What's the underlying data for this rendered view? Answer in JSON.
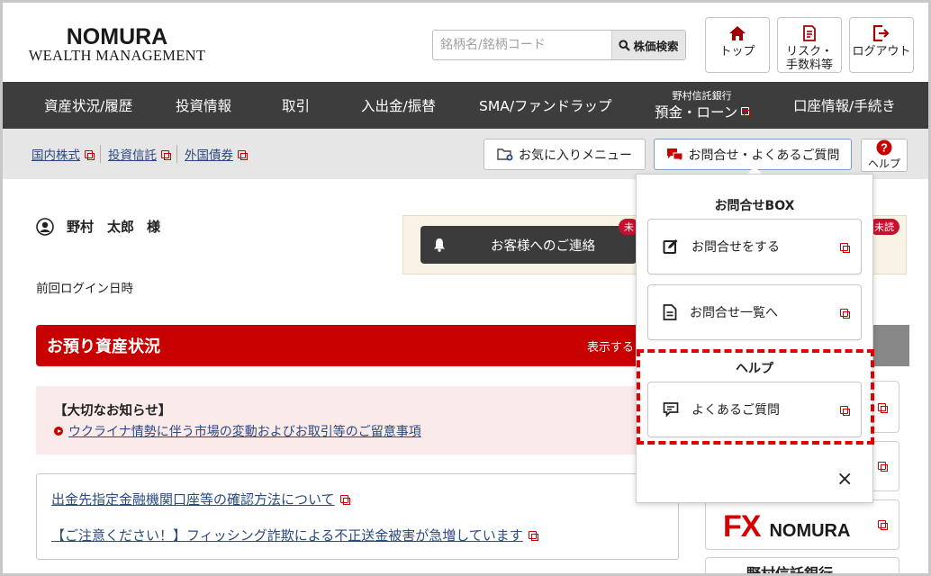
{
  "header": {
    "logo_top": "NOMURA",
    "logo_sub": "WEALTH MANAGEMENT",
    "search_placeholder": "銘柄名/銘柄コード",
    "search_button": "株価検索",
    "top_button": "トップ",
    "risk_button_line1": "リスク・",
    "risk_button_line2": "手数料等",
    "logout_button": "ログアウト"
  },
  "nav": {
    "items": [
      {
        "label": "資産状況/履歴"
      },
      {
        "label": "投資情報"
      },
      {
        "label": "取引"
      },
      {
        "label": "入出金/振替"
      },
      {
        "label": "SMA/ファンドラップ"
      },
      {
        "label": "預金・ローン",
        "small": "野村信託銀行"
      },
      {
        "label": "口座情報/手続き"
      }
    ]
  },
  "subbar": {
    "links": [
      "国内株式",
      "投資信託",
      "外国債券"
    ],
    "favorites_button": "お気に入りメニュー",
    "inquiry_button": "お問合せ・よくあるご質問",
    "help_button": "ヘルプ"
  },
  "user": {
    "name": "野村　太郎",
    "honorific": "様",
    "last_login_label": "前回ログイン日時"
  },
  "notice": {
    "contact_label": "お客様へのご連絡",
    "unread_badge": "未",
    "unread_badge2": "未読"
  },
  "assets": {
    "title": "お預り資産状況",
    "toggle_label": "表示する"
  },
  "important": {
    "title": "【大切なお知らせ】",
    "link": "ウクライナ情勢に伴う市場の変動およびお取引等のご留意事項"
  },
  "links_box": {
    "link1": "出金先指定金融機関口座等の確認方法について",
    "link2": "【ご注意ください！】フィッシング詐欺による不正送金被害が急増しています"
  },
  "right_column": {
    "fx_label": "FX",
    "fx_brand": "NOMURA",
    "trust_bank": "野村信託銀行"
  },
  "dropdown": {
    "section1": "お問合せBOX",
    "item1": "お問合せをする",
    "item2": "お問合せ一覧へ",
    "section2": "ヘルプ",
    "item3": "よくあるご質問",
    "close": "×"
  },
  "colors": {
    "brand_red": "#c80000",
    "nav_bg": "#3d3d3d",
    "link_blue": "#2b4a80",
    "highlight": "#e00000"
  }
}
